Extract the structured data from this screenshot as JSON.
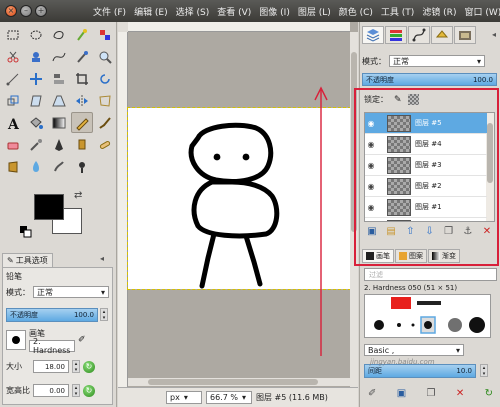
{
  "menubar": {
    "items": [
      "文件 (F)",
      "编辑 (E)",
      "选择 (S)",
      "查看 (V)",
      "图像 (I)",
      "图层 (L)",
      "颜色 (C)",
      "工具 (T)",
      "滤镜 (R)",
      "窗口 (W)"
    ]
  },
  "toolbox": {
    "tool_icons": [
      "rect-select-icon",
      "ellipse-select-icon",
      "free-select-icon",
      "fuzzy-select-icon",
      "select-by-color-icon",
      "scissors-icon",
      "foreground-select-icon",
      "paths-icon",
      "color-picker-icon",
      "zoom-icon",
      "measure-icon",
      "move-icon",
      "align-icon",
      "crop-icon",
      "rotate-icon",
      "scale-icon",
      "shear-icon",
      "perspective-icon",
      "flip-icon",
      "cage-icon",
      "text-icon",
      "bucket-fill-icon",
      "blend-icon",
      "pencil-icon",
      "paintbrush-icon",
      "eraser-icon",
      "airbrush-icon",
      "ink-icon",
      "clone-icon",
      "heal-icon",
      "perspective-clone-icon",
      "blur-icon",
      "smudge-icon",
      "dodge-icon"
    ],
    "active_tool": "pencil-icon",
    "colors": {
      "foreground": "#000000",
      "background": "#ffffff"
    }
  },
  "tool_options": {
    "tab_label": "工具选项",
    "heading": "铅笔",
    "mode_label": "模式：",
    "mode_value": "正常",
    "opacity_label": "不透明度",
    "opacity_value": "100.0",
    "brush_label": "画笔",
    "brush_value": "2. Hardness",
    "size_label": "大小",
    "size_value": "18.00",
    "aspect_label": "宽高比",
    "aspect_value": "0.00"
  },
  "status": {
    "unit": "px",
    "zoom": "66.7 %",
    "info": "图层 #5 (11.6 MB)"
  },
  "layers_dock": {
    "mode_label": "模式：",
    "mode_value": "正常",
    "opacity_label": "不透明度",
    "opacity_value": "100.0",
    "lock_label": "锁定：",
    "layers": [
      {
        "name": "图层 #5",
        "selected": true
      },
      {
        "name": "图层 #4",
        "selected": false
      },
      {
        "name": "图层 #3",
        "selected": false
      },
      {
        "name": "图层 #2",
        "selected": false
      },
      {
        "name": "图层 #1",
        "selected": false
      },
      {
        "name": "",
        "selected": false
      }
    ]
  },
  "brushes_dock": {
    "tabs": [
      "画笔",
      "图案",
      "渐变"
    ],
    "search_placeholder": "过滤",
    "brush_name": "2. Hardness 050 (51 × 51)",
    "preset_value": "Basic ,",
    "spacing_label": "间距",
    "spacing_value": "10.0"
  },
  "watermark": "jingyan.baidu.com",
  "accent_colors": {
    "selection": "#5ea9e2",
    "annotation_red": "#d8203a"
  }
}
